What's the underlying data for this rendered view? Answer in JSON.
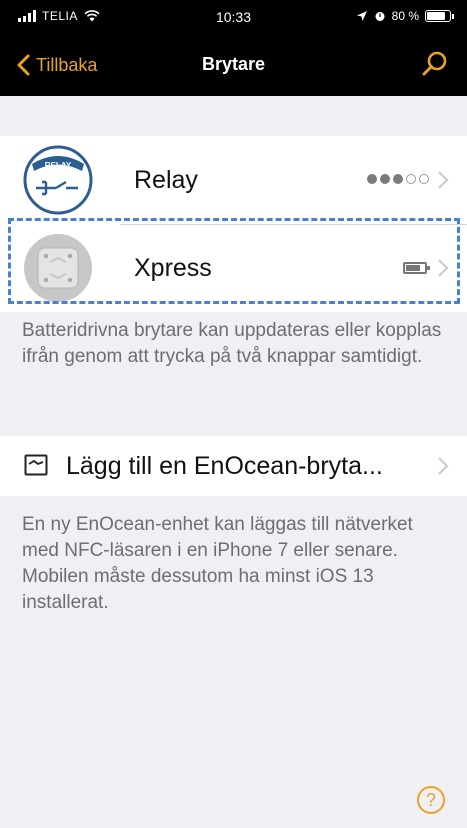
{
  "status_bar": {
    "carrier": "TELIA",
    "time": "10:33",
    "battery_text": "80 %",
    "battery_level": 0.8
  },
  "nav": {
    "back_label": "Tillbaka",
    "title": "Brytare"
  },
  "switches": [
    {
      "name": "Relay",
      "badge_text": "RELAY",
      "signal_strength": 3,
      "signal_max": 5
    },
    {
      "name": "Xpress",
      "battery_level": 0.8
    }
  ],
  "battery_hint": "Batteridrivna brytare kan uppdateras eller kopplas ifrån genom att trycka på två knappar samtidigt.",
  "add_switch": {
    "label": "Lägg till en EnOcean-bryta..."
  },
  "add_hint": "En ny EnOcean-enhet kan läggas till nätverket med NFC-läsaren i en iPhone 7 eller senare. Mobilen måste dessutom ha minst iOS 13 installerat.",
  "help": {
    "label": "?"
  },
  "colors": {
    "accent": "#e8a326",
    "highlight": "#4a7fd1",
    "background": "#efeff4"
  }
}
